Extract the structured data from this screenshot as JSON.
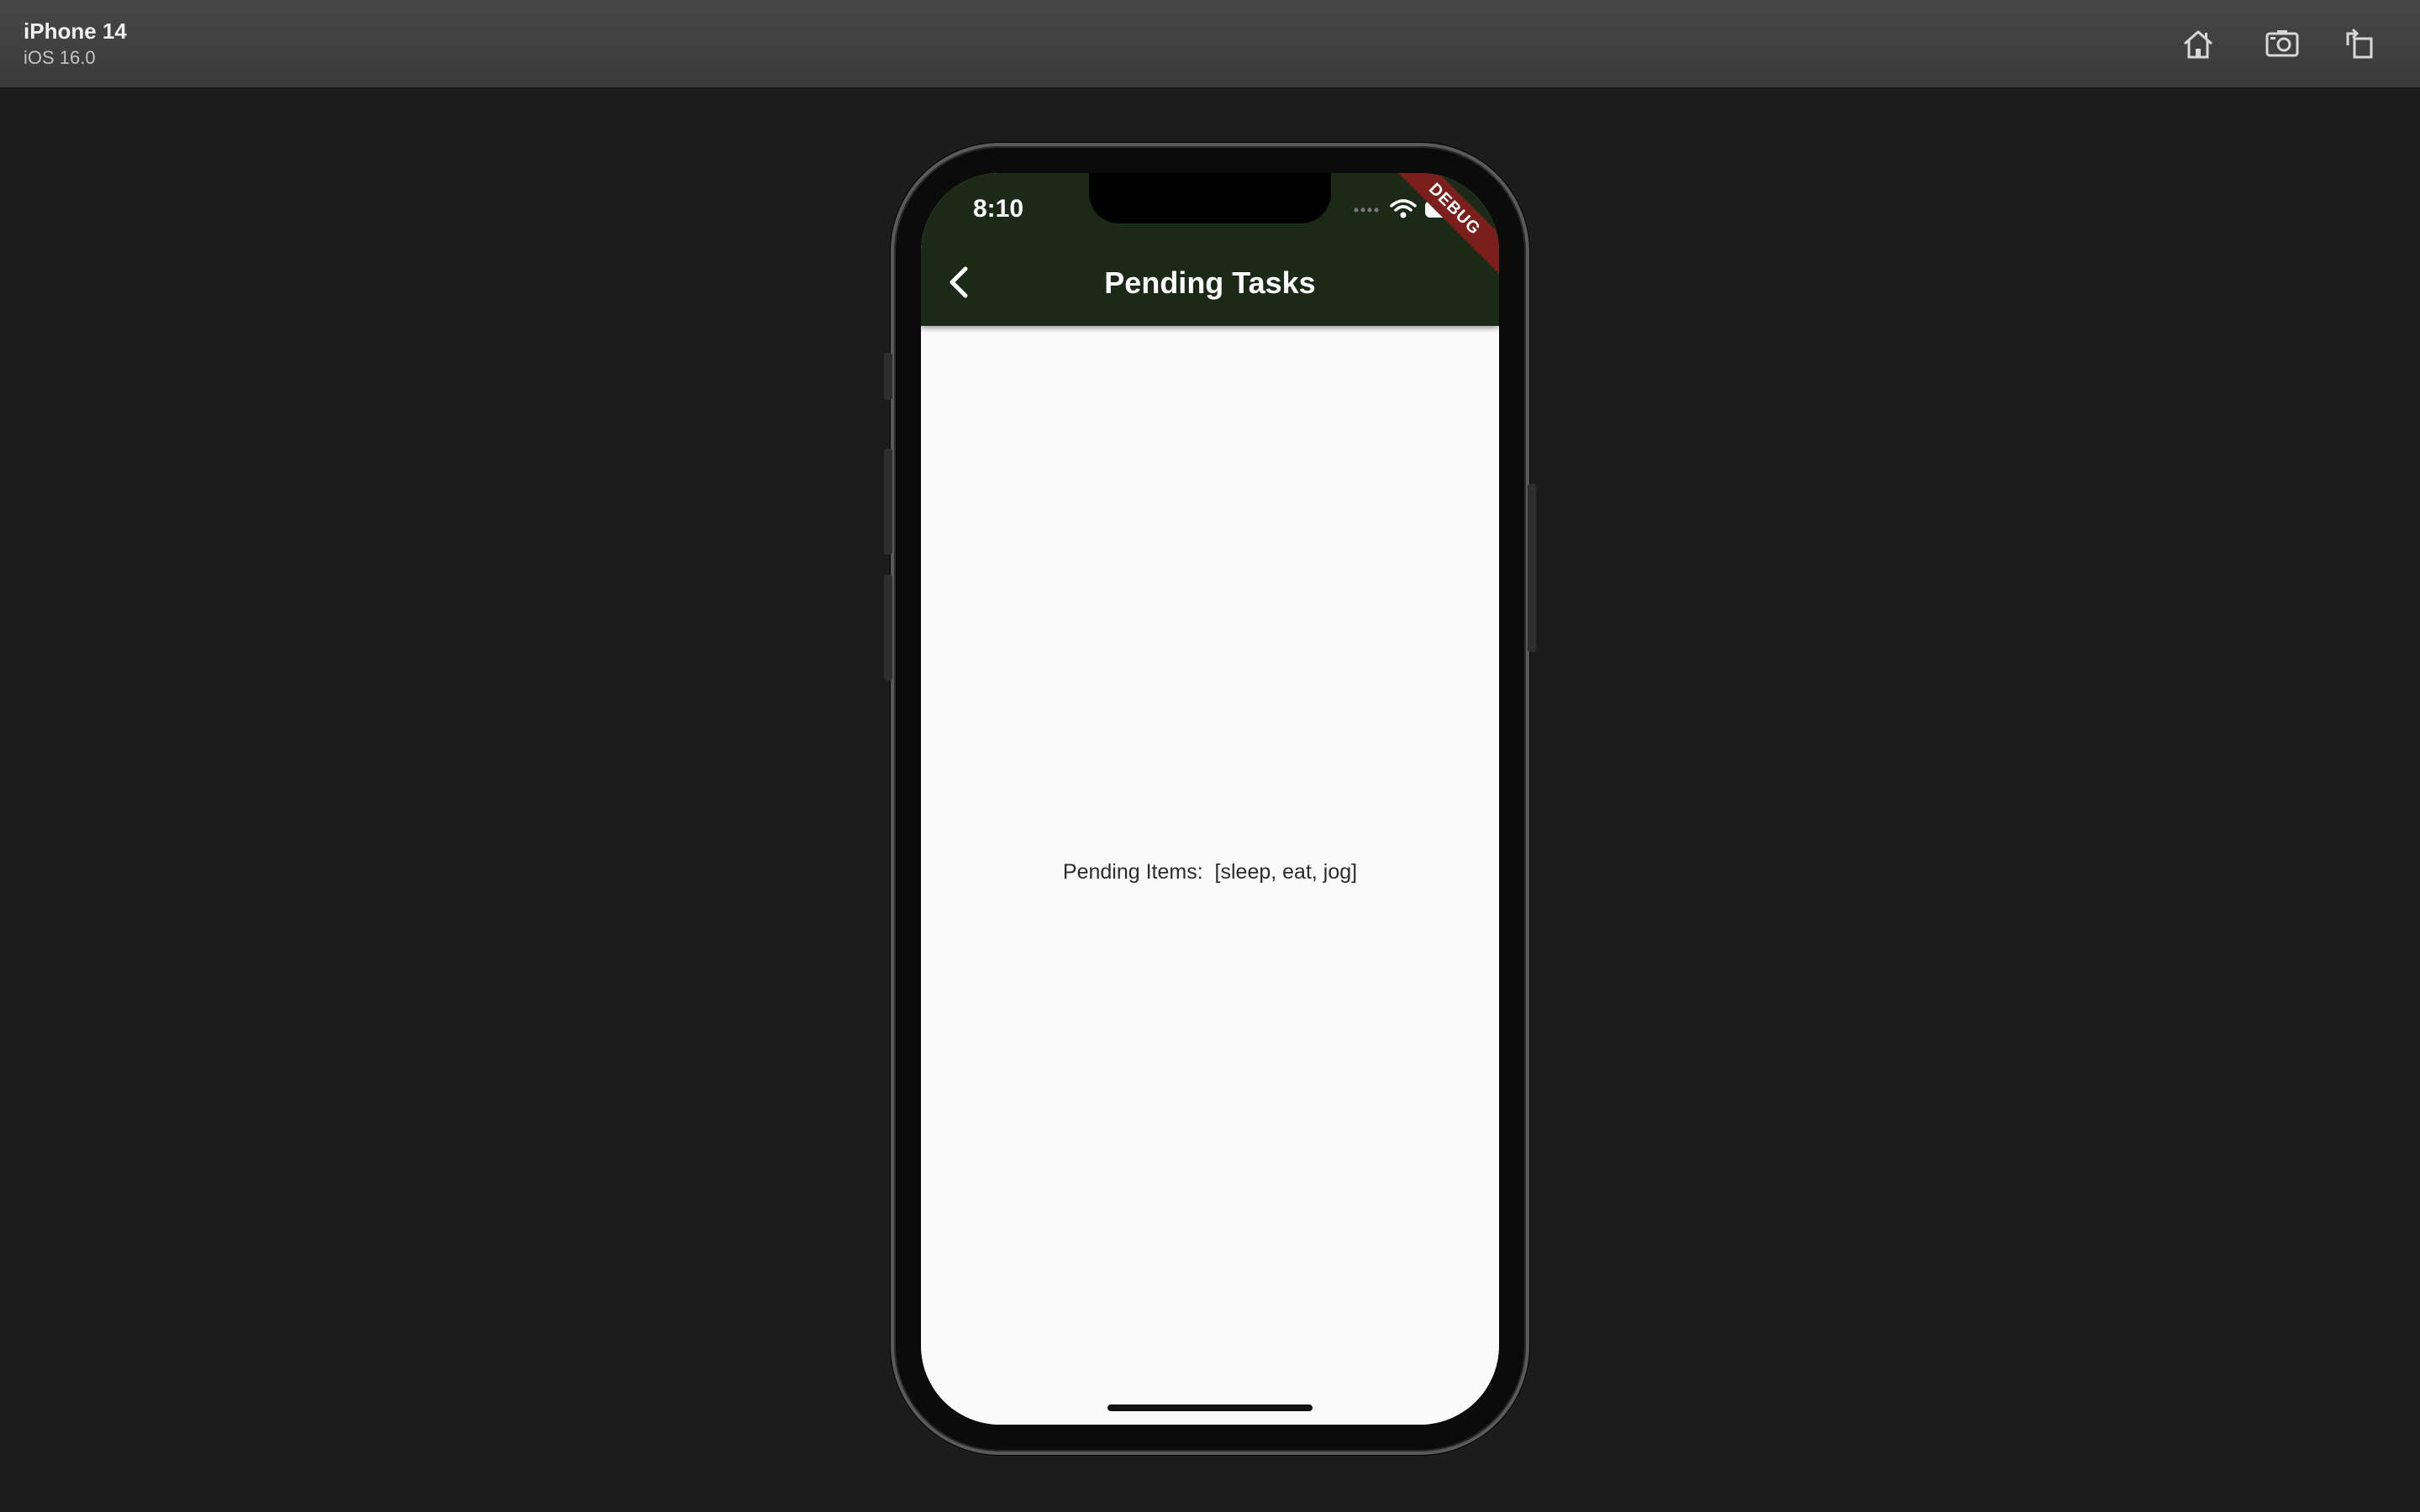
{
  "simulator": {
    "device_name": "iPhone 14",
    "os_version": "iOS 16.0",
    "toolbar_icons": [
      "home-icon",
      "screenshot-icon",
      "rotate-icon"
    ]
  },
  "status_bar": {
    "time": "8:10",
    "icons": [
      "signal-icon",
      "wifi-icon",
      "battery-icon"
    ]
  },
  "debug_banner": "DEBUG",
  "app_bar": {
    "title": "Pending Tasks",
    "back_icon": "chevron-left-icon",
    "color": "#1b2a17"
  },
  "content": {
    "text": "Pending Items:  [sleep, eat, jog]",
    "background": "#fafafa"
  }
}
